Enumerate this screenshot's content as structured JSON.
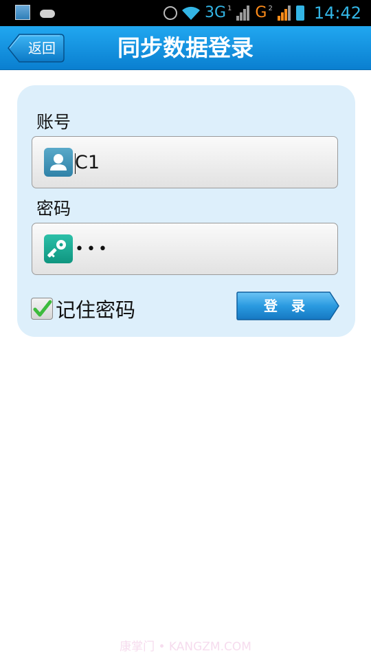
{
  "status_bar": {
    "network_3g": "3G",
    "network_g": "G",
    "sim1": "1",
    "sim2": "2",
    "time": "14:42"
  },
  "header": {
    "back_label": "返回",
    "title": "同步数据登录"
  },
  "form": {
    "account_label": "账号",
    "account_value": "C1",
    "password_label": "密码",
    "password_value": "•••",
    "remember_label": "记住密码",
    "remember_checked": true,
    "login_label": "登录"
  },
  "colors": {
    "header_blue": "#1592e0",
    "card_bg": "#ddeffb",
    "status_blue": "#33b5e5",
    "status_orange": "#ff8c1a"
  },
  "icons": {
    "account": "user-icon",
    "password": "key-icon",
    "back": "back-arrow-button",
    "remember": "checkmark-icon"
  },
  "watermark": "康掌门 • KANGZM.COM"
}
